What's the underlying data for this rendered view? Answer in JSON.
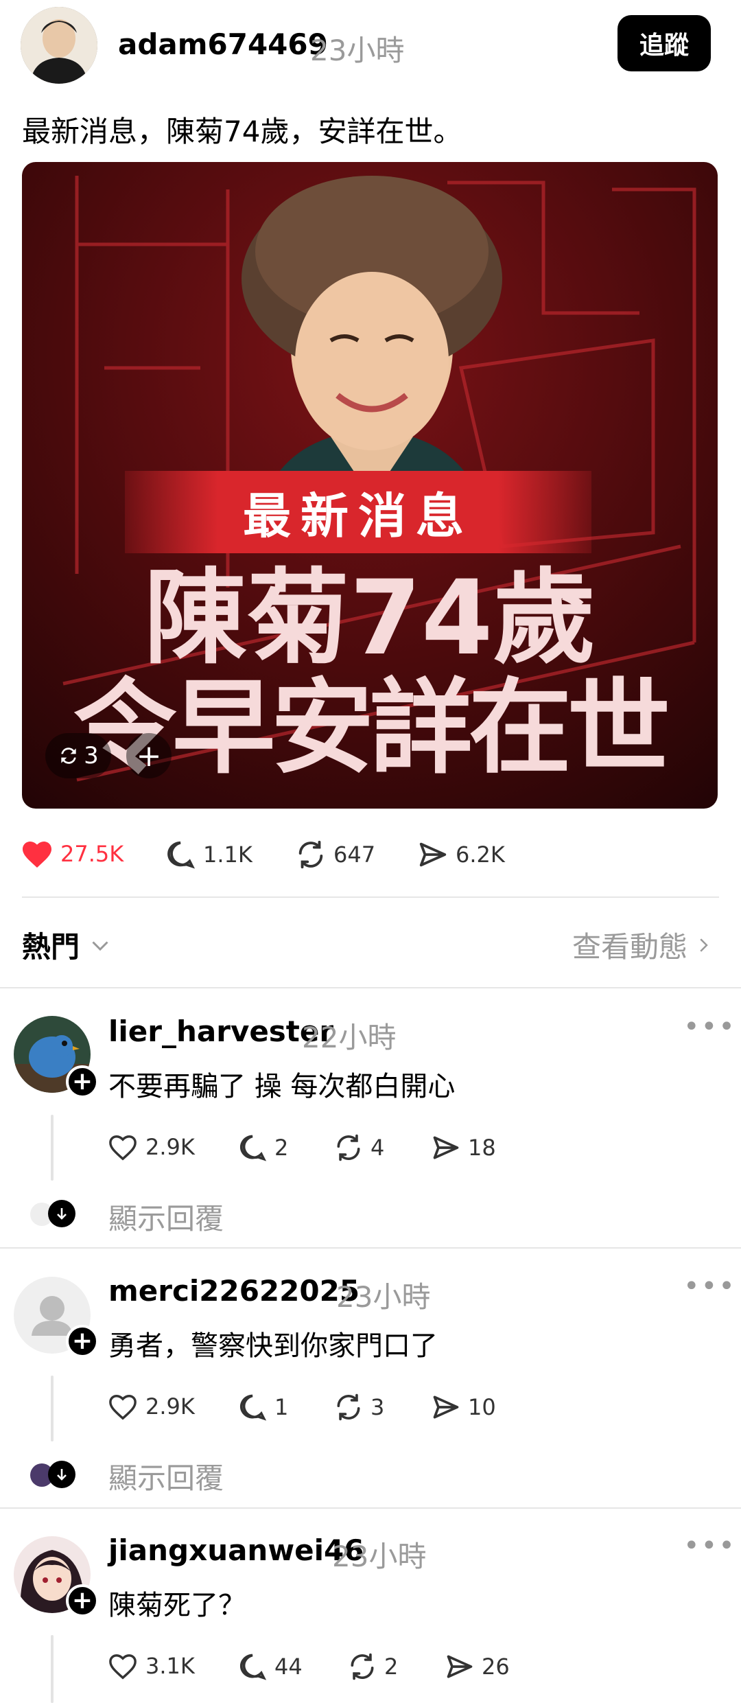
{
  "post": {
    "username": "adam674469",
    "time": "23小時",
    "follow_label": "追蹤",
    "text": "最新消息，陳菊74歲，安詳在世。",
    "image": {
      "banner": "最新消息",
      "line1": "陳菊74歲",
      "line2": "令早安詳在世",
      "repost_count": "3",
      "add_label": "+"
    },
    "stats": {
      "likes": "27.5K",
      "comments": "1.1K",
      "reposts": "647",
      "shares": "6.2K"
    }
  },
  "sort": {
    "label": "熱門",
    "activity_label": "查看動態"
  },
  "replies": [
    {
      "username": "lier_harvester",
      "time": "22小時",
      "text": "不要再騙了 操 每次都白開心",
      "likes": "2.9K",
      "comments": "2",
      "reposts": "4",
      "shares": "18",
      "show_replies": "顯示回覆"
    },
    {
      "username": "merci22622025",
      "time": "23小時",
      "text": "勇者，警察快到你家門口了",
      "likes": "2.9K",
      "comments": "1",
      "reposts": "3",
      "shares": "10",
      "show_replies": "顯示回覆"
    },
    {
      "username": "jiangxuanwei46",
      "time": "23小時",
      "text": "陳菊死了？",
      "likes": "3.1K",
      "comments": "44",
      "reposts": "2",
      "shares": "26"
    }
  ],
  "colors": {
    "like_red": "#ff3040",
    "banner_red": "#d9262c",
    "image_bg": "#4a0a0c"
  },
  "icons": [
    "heart-icon",
    "comment-icon",
    "repost-icon",
    "share-icon",
    "chevron-down-icon",
    "chevron-right-icon",
    "more-icon",
    "plus-icon",
    "arrow-down-icon"
  ]
}
